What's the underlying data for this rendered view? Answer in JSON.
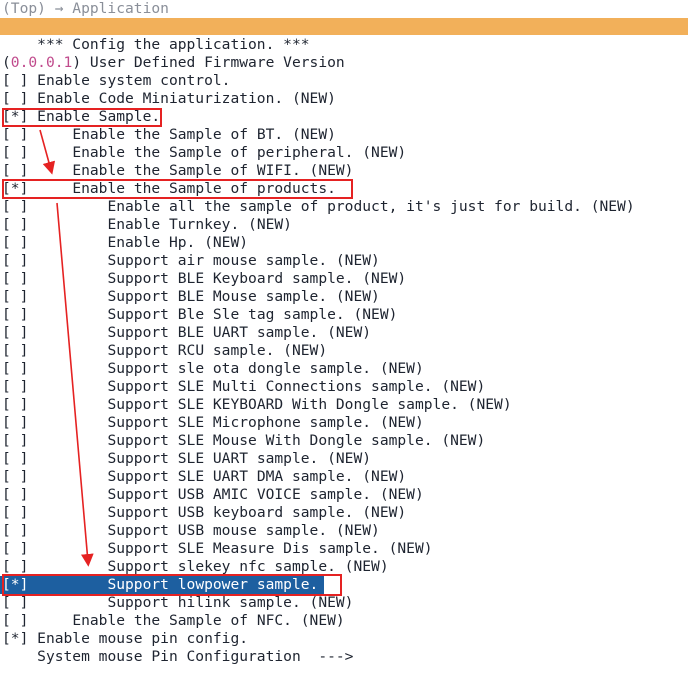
{
  "header": {
    "breadcrumb": "(Top) → Application"
  },
  "menu": {
    "heading": "*** Config the application. ***",
    "version_prefix": "(",
    "version_value": "0.0.0.1",
    "version_suffix": ") User Defined Firmware Version",
    "items": [
      {
        "box": "[ ]",
        "indent": "",
        "label": "Enable system control."
      },
      {
        "box": "[ ]",
        "indent": "",
        "label": "Enable Code Miniaturization. (NEW)"
      },
      {
        "box": "[*]",
        "indent": "",
        "label": "Enable Sample."
      },
      {
        "box": "[ ]",
        "indent": "    ",
        "label": "Enable the Sample of BT. (NEW)"
      },
      {
        "box": "[ ]",
        "indent": "    ",
        "label": "Enable the Sample of peripheral. (NEW)"
      },
      {
        "box": "[ ]",
        "indent": "    ",
        "label": "Enable the Sample of WIFI. (NEW)"
      },
      {
        "box": "[*]",
        "indent": "    ",
        "label": "Enable the Sample of products."
      },
      {
        "box": "[ ]",
        "indent": "        ",
        "label": "Enable all the sample of product, it's just for build. (NEW)"
      },
      {
        "box": "[ ]",
        "indent": "        ",
        "label": "Enable Turnkey. (NEW)"
      },
      {
        "box": "[ ]",
        "indent": "        ",
        "label": "Enable Hp. (NEW)"
      },
      {
        "box": "[ ]",
        "indent": "        ",
        "label": "Support air mouse sample. (NEW)"
      },
      {
        "box": "[ ]",
        "indent": "        ",
        "label": "Support BLE Keyboard sample. (NEW)"
      },
      {
        "box": "[ ]",
        "indent": "        ",
        "label": "Support BLE Mouse sample. (NEW)"
      },
      {
        "box": "[ ]",
        "indent": "        ",
        "label": "Support Ble Sle tag sample. (NEW)"
      },
      {
        "box": "[ ]",
        "indent": "        ",
        "label": "Support BLE UART sample. (NEW)"
      },
      {
        "box": "[ ]",
        "indent": "        ",
        "label": "Support RCU sample. (NEW)"
      },
      {
        "box": "[ ]",
        "indent": "        ",
        "label": "Support sle ota dongle sample. (NEW)"
      },
      {
        "box": "[ ]",
        "indent": "        ",
        "label": "Support SLE Multi Connections sample. (NEW)"
      },
      {
        "box": "[ ]",
        "indent": "        ",
        "label": "Support SLE KEYBOARD With Dongle sample. (NEW)"
      },
      {
        "box": "[ ]",
        "indent": "        ",
        "label": "Support SLE Microphone sample. (NEW)"
      },
      {
        "box": "[ ]",
        "indent": "        ",
        "label": "Support SLE Mouse With Dongle sample. (NEW)"
      },
      {
        "box": "[ ]",
        "indent": "        ",
        "label": "Support SLE UART sample. (NEW)"
      },
      {
        "box": "[ ]",
        "indent": "        ",
        "label": "Support SLE UART DMA sample. (NEW)"
      },
      {
        "box": "[ ]",
        "indent": "        ",
        "label": "Support USB AMIC VOICE sample. (NEW)"
      },
      {
        "box": "[ ]",
        "indent": "        ",
        "label": "Support USB keyboard sample. (NEW)"
      },
      {
        "box": "[ ]",
        "indent": "        ",
        "label": "Support USB mouse sample. (NEW)"
      },
      {
        "box": "[ ]",
        "indent": "        ",
        "label": "Support SLE Measure Dis sample. (NEW)"
      },
      {
        "box": "[ ]",
        "indent": "        ",
        "label": "Support slekey nfc sample. (NEW)"
      },
      {
        "box": "[*]",
        "indent": "        ",
        "label": "Support lowpower sample.",
        "selected": true
      },
      {
        "box": "[ ]",
        "indent": "        ",
        "label": "Support hilink sample. (NEW)"
      },
      {
        "box": "[ ]",
        "indent": "    ",
        "label": "Enable the Sample of NFC. (NEW)"
      },
      {
        "box": "[*]",
        "indent": "",
        "label": "Enable mouse pin config."
      }
    ],
    "footer_item": "System mouse Pin Configuration  --->"
  },
  "colors": {
    "accent_bar": "#f2b05a",
    "selection": "#1d5fa0",
    "annotation": "#e52222",
    "version": "#c04a8c"
  }
}
